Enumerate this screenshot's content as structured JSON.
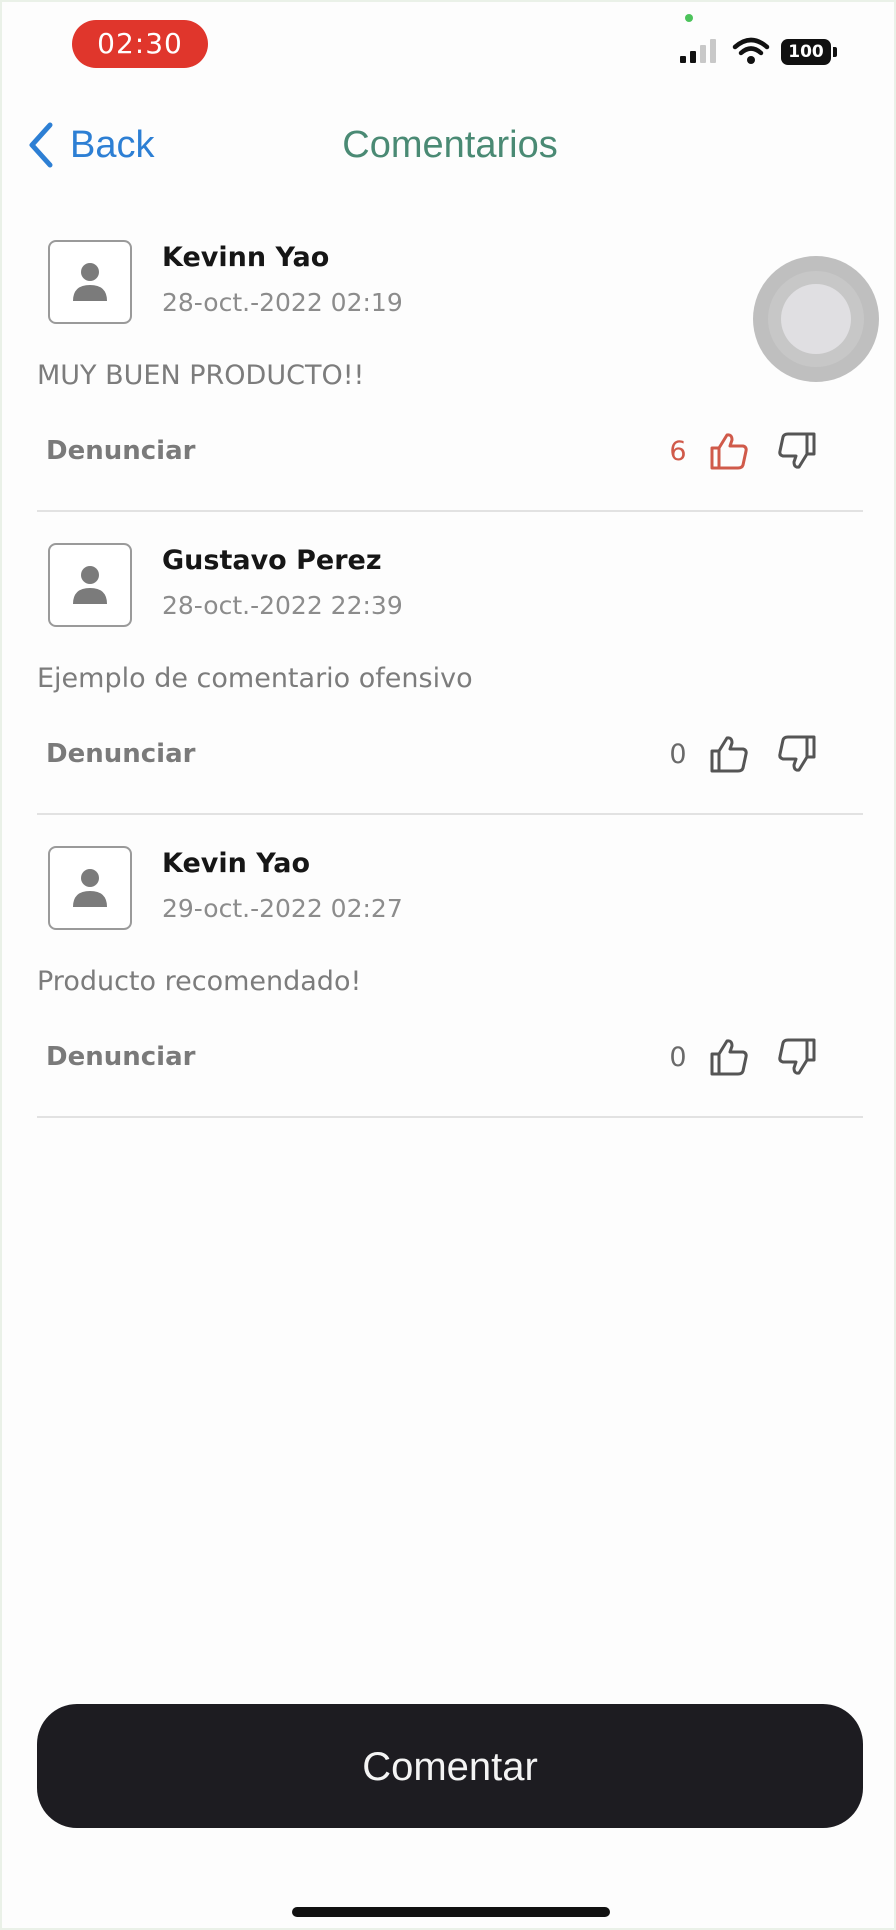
{
  "status_bar": {
    "time": "02:30",
    "battery": "100",
    "icons": [
      "signal-icon",
      "wifi-icon",
      "battery-icon"
    ]
  },
  "nav": {
    "back_label": "Back",
    "title": "Comentarios"
  },
  "comments": [
    {
      "author": "Kevinn Yao",
      "date": "28-oct.-2022 02:19",
      "text": "MUY BUEN PRODUCTO!!",
      "report_label": "Denunciar",
      "likes": "6",
      "liked": true
    },
    {
      "author": "Gustavo Perez",
      "date": "28-oct.-2022 22:39",
      "text": "Ejemplo de comentario ofensivo",
      "report_label": "Denunciar",
      "likes": "0",
      "liked": false
    },
    {
      "author": "Kevin Yao",
      "date": "29-oct.-2022 02:27",
      "text": "Producto recomendado!",
      "report_label": "Denunciar",
      "likes": "0",
      "liked": false
    }
  ],
  "footer": {
    "comment_button_label": "Comentar"
  },
  "colors": {
    "accent_blue": "#2d7fd4",
    "title_green": "#4a8a74",
    "liked_red": "#d05a4a",
    "time_pill_red": "#e0362c",
    "button_dark": "#1d1c21"
  }
}
